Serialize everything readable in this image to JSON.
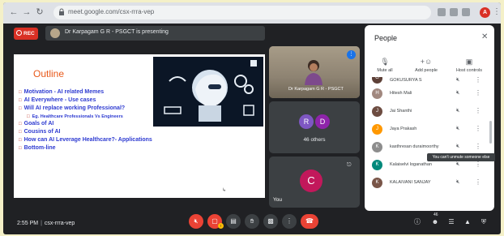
{
  "browser": {
    "url": "meet.google.com/csx-rrra-vep",
    "profile_initial": "A"
  },
  "meeting": {
    "rec_label": "REC",
    "presenting_text": "Dr Karpagam G R - PSGCT is presenting",
    "time": "2:55 PM",
    "code": "csx-rrra-vep",
    "participant_count": "46"
  },
  "slide": {
    "title": "Outline",
    "bullets": [
      "Motivation - AI related Memes",
      "AI Everywhere - Use cases",
      "Will AI replace working Professional?",
      "Eg. Healthcare Professionals Vs Engineers",
      "Goals of AI",
      "Cousins of AI",
      "How can AI Leverage Healthcare?- Applications",
      "Bottom-line"
    ]
  },
  "tiles": {
    "speaker_name": "Dr Karpagam G R - PSGCT",
    "others_avatars": [
      "R",
      "D"
    ],
    "others_label": "46 others",
    "self_initial": "C",
    "self_label": "You"
  },
  "people": {
    "title": "People",
    "actions": [
      {
        "label": "Mute all",
        "icon": "mic-off-icon"
      },
      {
        "label": "Add people",
        "icon": "add-person-icon"
      },
      {
        "label": "Host controls",
        "icon": "host-controls-icon"
      }
    ],
    "list": [
      {
        "name": "GOKUSURYA S",
        "initial": "G"
      },
      {
        "name": "Hitesh Mali",
        "initial": "H"
      },
      {
        "name": "Jai Shanthi",
        "initial": "J"
      },
      {
        "name": "Jaya Prakash",
        "initial": "J"
      },
      {
        "name": "kasthresan duraimoorthy",
        "initial": "K"
      },
      {
        "name": "Kalaiselvi loganathan",
        "initial": "K"
      },
      {
        "name": "KALAIVANI SANJAY",
        "initial": "K"
      }
    ],
    "tooltip": "You can't unmute someone else"
  },
  "colors": {
    "rec": "#d93025",
    "accent_blue": "#1a73e8",
    "end_call": "#ea4335",
    "slide_title": "#e8591a",
    "slide_bullets": "#2e3bd1"
  }
}
